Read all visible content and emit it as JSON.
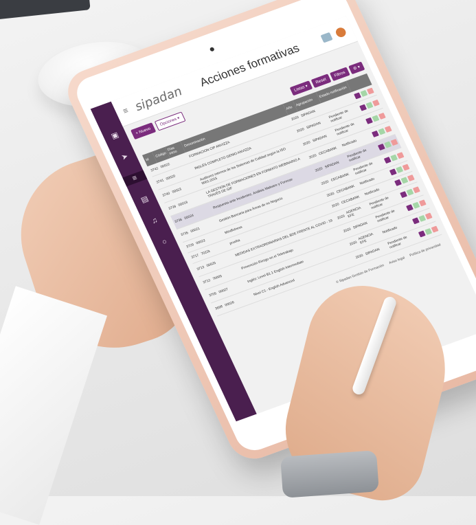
{
  "app": {
    "brand": "sipadan",
    "page_title": "Acciones formativas"
  },
  "sidebar": {
    "icons": [
      "home-icon",
      "send-icon",
      "graduation-icon",
      "book-icon",
      "headset-icon",
      "chat-icon"
    ]
  },
  "toolbar": {
    "new_label": "+ Nuevo",
    "options_label": "Opciones ▾",
    "listas_label": "Listas ▾",
    "reset_label": "Reset",
    "filtros_label": "Filtros",
    "more_label": "⚙ ▾"
  },
  "table": {
    "columns": [
      "Id",
      "Código",
      "Días inicio",
      "Denominación",
      "Año",
      "Agrupación",
      "Estado notificación",
      ""
    ],
    "rows": [
      {
        "id": "3742",
        "codigo": "00022",
        "dias": "",
        "denominacion": "FORMACION CIP ANVIZZA",
        "anio": "2020",
        "agrupacion": "SIPADAN",
        "estado": ""
      },
      {
        "id": "3741",
        "codigo": "00020",
        "dias": "",
        "denominacion": "INGLÉS COMPLETO GENIO ANVIZZA",
        "anio": "2020",
        "agrupacion": "SIPADAN",
        "estado": "Pendiente de notificar"
      },
      {
        "id": "3740",
        "codigo": "00023",
        "dias": "",
        "denominacion": "Auditores internos de los Sistemas de Calidad según la ISO 9001:2015",
        "anio": "2020",
        "agrupacion": "SIPADAN",
        "estado": "Pendiente de notificar"
      },
      {
        "id": "3739",
        "codigo": "00019",
        "dias": "",
        "denominacion": "LA GESTION DE FORMACIONES EN FORMATO WEBINARIO A TRAVÉS DE GIF",
        "anio": "2020",
        "agrupacion": "CECABANK",
        "estado": "Notificado"
      },
      {
        "id": "3736",
        "codigo": "00024",
        "dias": "",
        "denominacion": "Respuesta ante Incidentes. Análisis Malware y Forense",
        "anio": "2020",
        "agrupacion": "SIPADAN",
        "estado": "Pendiente de notificar"
      },
      {
        "id": "3735",
        "codigo": "00021",
        "dias": "",
        "denominacion": "Gestión Bancaria para Áreas de no Negocio",
        "anio": "2020",
        "agrupacion": "CECABANK",
        "estado": "Pendiente de notificar"
      },
      {
        "id": "3729",
        "codigo": "00022",
        "dias": "",
        "denominacion": "Mindfulness",
        "anio": "2020",
        "agrupacion": "CECABANK",
        "estado": "Notificado"
      },
      {
        "id": "3717",
        "codigo": "7022k",
        "dias": "",
        "denominacion": "prueba",
        "anio": "2020",
        "agrupacion": "CECABANK",
        "estado": "Notificado"
      },
      {
        "id": "3713",
        "codigo": "00025",
        "dias": "",
        "denominacion": "MEDIDAS EXTRAORDINARIAS DEL BDE FRENTE AL COVID - 19",
        "anio": "2020",
        "agrupacion": "AGENCIA EFE",
        "estado": "Pendiente de notificar"
      },
      {
        "id": "3712",
        "codigo": "70005",
        "dias": "",
        "denominacion": "Prevención Riesgo en el Teletrabajo",
        "anio": "2020",
        "agrupacion": "SIPADAN",
        "estado": "Pendiente de notificar"
      },
      {
        "id": "3705",
        "codigo": "00027",
        "dias": "",
        "denominacion": "Inglés: Level B1.1 English Intermediate",
        "anio": "2020",
        "agrupacion": "AGENCIA EFE",
        "estado": "Notificado"
      },
      {
        "id": "3698",
        "codigo": "00026",
        "dias": "",
        "denominacion": "Nivel C1 - English Advanced",
        "anio": "2020",
        "agrupacion": "SIPADAN",
        "estado": "Pendiente de notificar"
      }
    ]
  },
  "footer": {
    "links": [
      "© Sipadan Gestión de Formación",
      "Aviso legal",
      "Política de privacidad"
    ]
  }
}
